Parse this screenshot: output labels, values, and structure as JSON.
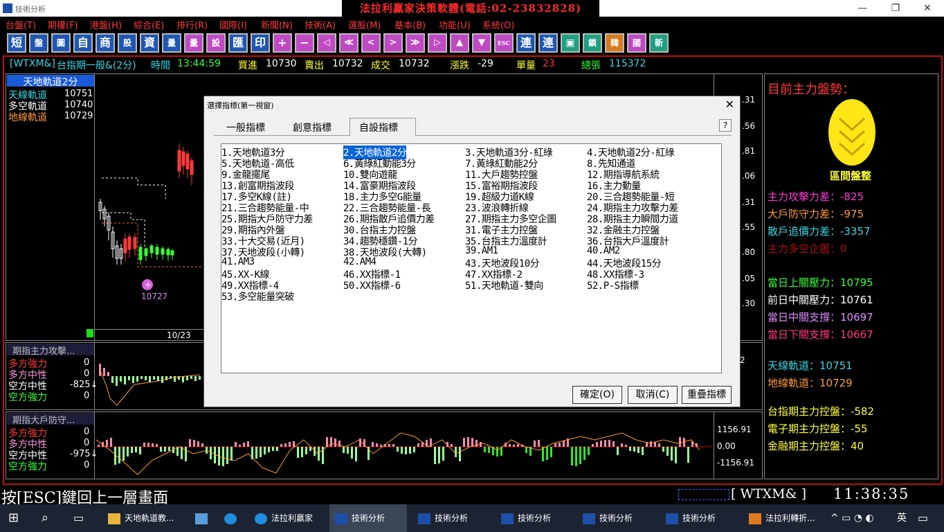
{
  "window": {
    "app_title": "技術分析",
    "banner": "法拉利贏家決策軟體(電話:02-23832828)"
  },
  "menu": [
    "台盤(T)",
    "期權(F)",
    "港盤(H)",
    "綜合(E)",
    "排行(R)",
    "國際(I)",
    "新聞(N)",
    "技術(A)",
    "選股(M)",
    "基本(B)",
    "功能(U)",
    "系統(O)"
  ],
  "toolbar": [
    "短",
    "盤",
    "圖",
    "自",
    "商",
    "股",
    "資",
    "量",
    "量",
    "設",
    "匯",
    "印",
    "+",
    "−",
    "◁",
    "≪",
    "<",
    ">",
    "≫",
    "▷",
    "▲",
    "▼",
    "ESC",
    "連",
    "連",
    "▣",
    "鎖",
    "韓",
    "國",
    "新"
  ],
  "infobar": {
    "symbol": "[WTXM&]",
    "name": "台指期一般&(2分)",
    "time_label": "時間",
    "time": "13:44:59",
    "bid_label": "買進",
    "bid": "10730",
    "ask_label": "賣出",
    "ask": "10732",
    "deal_label": "成交",
    "deal": "10732",
    "change_label": "漲跌",
    "change": "-29",
    "qty_label": "單量",
    "qty": "23",
    "total_label": "總張",
    "total": "115372"
  },
  "main_chart": {
    "indicator_title": "天地軌道2分",
    "rows": [
      {
        "label": "天線軌道",
        "value": "10751"
      },
      {
        "label": "多空軌道",
        "value": "10740"
      },
      {
        "label": "地線軌道",
        "value": "10729"
      }
    ],
    "marker_value": "10727",
    "date_label": "10/23",
    "right_axis": [
      ".31",
      ".56",
      ".81",
      ".06",
      ".31",
      ".55",
      ".80",
      ".05",
      ".30"
    ]
  },
  "sub1": {
    "title": "期指主力攻擊...",
    "rows": [
      {
        "label": "多方強力",
        "value": "0"
      },
      {
        "label": "多方中性",
        "value": "0"
      },
      {
        "label": "空方中性",
        "value": "-825↓"
      },
      {
        "label": "空方強力",
        "value": "0"
      }
    ],
    "right_axis": [
      "2"
    ]
  },
  "sub2": {
    "title": "期指大戶防守...",
    "rows": [
      {
        "label": "多方強力",
        "value": "0"
      },
      {
        "label": "多方中性",
        "value": "0"
      },
      {
        "label": "空方中性",
        "value": "-975↓"
      },
      {
        "label": "空方強力",
        "value": "0"
      }
    ],
    "right_axis": [
      "1156.91",
      "0.00",
      "-1156.91"
    ]
  },
  "right_panel": {
    "heading": "目前主力盤勢：",
    "state": "區間盤整",
    "lines1": [
      {
        "text": "主力攻擊力差：-825",
        "color": "#ff3bd7"
      },
      {
        "text": "大戶防守力差：-975",
        "color": "#ff9a3b"
      },
      {
        "text": "散戶追價力差：-3357",
        "color": "#3bd7e6"
      },
      {
        "text": "主力多空企圖：0",
        "color": "#b01010"
      }
    ],
    "lines2": [
      {
        "text": "當日上關壓力：10795",
        "color": "#3bff3b"
      },
      {
        "text": "前日中關壓力：10761",
        "color": "#ffffff"
      },
      {
        "text": "當日中關支撐：10697",
        "color": "#e08cff"
      },
      {
        "text": "當日下關支撐：10667",
        "color": "#ff3b7d"
      }
    ],
    "lines3": [
      {
        "text": "天線軌道：10751",
        "color": "#3bd7e6"
      },
      {
        "text": "地線軌道：10729",
        "color": "#ff9a3b"
      }
    ],
    "lines4": [
      {
        "text": "台指期主力控盤：-582",
        "color": "#ffff3b"
      },
      {
        "text": "電子期主力控盤：-55",
        "color": "#ffff3b"
      },
      {
        "text": "金融期主力控盤：40",
        "color": "#ffff3b"
      }
    ]
  },
  "dialog": {
    "title": "選擇指標(第一視窗)",
    "tabs": [
      "一般指標",
      "創意指標",
      "自設指標"
    ],
    "help": "?",
    "items": [
      "1.天地軌道3分",
      "2.天地軌道2分",
      "3.天地軌道3分-紅綠",
      "4.天地軌道2分-紅綠",
      "5.天地軌道-高低",
      "6.黃綠紅動能3分",
      "7.黃綠紅動能2分",
      "8.先知通道",
      "9.金龍擺尾",
      "10.雙向遊龍",
      "11.大戶趨勢控盤",
      "12.期指導航系統",
      "13.創富期指波段",
      "14.富豪期指波段",
      "15.富裕期指波段",
      "16.主力動量",
      "17.多空K線(註)",
      "18.主力多空G能量",
      "19.超級力道K線",
      "20.三合趨勢能量-短",
      "21.三合趨勢能量-中",
      "22.三合趨勢能量-長",
      "23.波浪轉折線",
      "24.期指主力攻擊力差",
      "25.期指大戶防守力差",
      "26.期指散戶追價力差",
      "27.期指主力多空企圖",
      "28.期指主力瞬間力道",
      "29.期指內外盤",
      "30.台指主力控盤",
      "31.電子主力控盤",
      "32.金融主力控盤",
      "33.十大交易(近月)",
      "34.趨勢穩鑽-1分",
      "35.台指主力溫度計",
      "36.台指大戶溫度計",
      "37.天地波段(小轉)",
      "38.天地波段(大轉)",
      "39.AM1",
      "40.AM2",
      "41.AM3",
      "42.AM4",
      "43.天地波段10分",
      "44.天地波段15分",
      "45.XX-K線",
      "46.XX指標-1",
      "47.XX指標-2",
      "48.XX指標-3",
      "49.XX指標-4",
      "50.XX指標-6",
      "51.天地軌道-雙向",
      "52.P-S指標",
      "53.多空能量突破"
    ],
    "selected_index": 1,
    "buttons": {
      "ok": "確定(O)",
      "cancel": "取消(C)",
      "overlay": "重疊指標"
    }
  },
  "status": {
    "hint": "按[ESC]鍵回上一層畫面",
    "symbol": "[ WTXM&  ]",
    "clock": "11:38:35"
  },
  "taskbar": {
    "items": [
      "天地軌道教...",
      "法拉利贏家",
      "技術分析",
      "技術分析",
      "技術分析",
      "技術分析",
      "技術分析",
      "法拉利轉折..."
    ],
    "ime": "英"
  }
}
